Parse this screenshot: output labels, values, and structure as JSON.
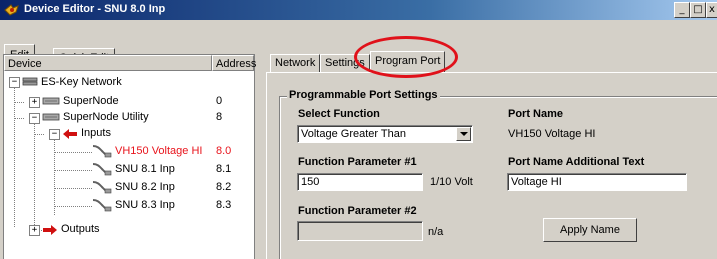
{
  "window": {
    "title": "Device Editor - SNU 8.0 Inp",
    "controls": {
      "minimize": "_",
      "maximize": "□",
      "close": "x"
    }
  },
  "menubar": {
    "tabs": [
      "Edit",
      "Quick Edit"
    ]
  },
  "tree": {
    "headers": {
      "device": "Device",
      "address": "Address"
    },
    "nodes": [
      {
        "label": "ES-Key Network",
        "address": "",
        "expander": "−"
      },
      {
        "label": "SuperNode",
        "address": "0",
        "expander": "+"
      },
      {
        "label": "SuperNode Utility",
        "address": "8",
        "expander": "−"
      },
      {
        "label": "Inputs",
        "address": "",
        "expander": "−"
      },
      {
        "label": "VH150 Voltage HI",
        "address": "8.0",
        "selected_color": "#e8141c"
      },
      {
        "label": "SNU 8.1 Inp",
        "address": "8.1"
      },
      {
        "label": "SNU 8.2 Inp",
        "address": "8.2"
      },
      {
        "label": "SNU 8.3 Inp",
        "address": "8.3"
      },
      {
        "label": "Outputs",
        "address": "",
        "expander": "+"
      }
    ]
  },
  "tabs": [
    "Network",
    "Settings",
    "Program Port"
  ],
  "program_port": {
    "group_title": "Programmable Port Settings",
    "select_function_label": "Select Function",
    "select_function_value": "Voltage Greater Than",
    "port_name_label": "Port Name",
    "port_name_value": "VH150 Voltage HI",
    "param1_label": "Function Parameter #1",
    "param1_value": "150",
    "param1_unit": "1/10 Volt",
    "additional_text_label": "Port Name Additional Text",
    "additional_text_value": "Voltage HI",
    "param2_label": "Function Parameter #2",
    "param2_value": "",
    "param2_unit": "n/a",
    "apply_button": "Apply Name"
  },
  "colors": {
    "annotation_ellipse": "#e0111a",
    "titlebar": "#0a246a"
  }
}
